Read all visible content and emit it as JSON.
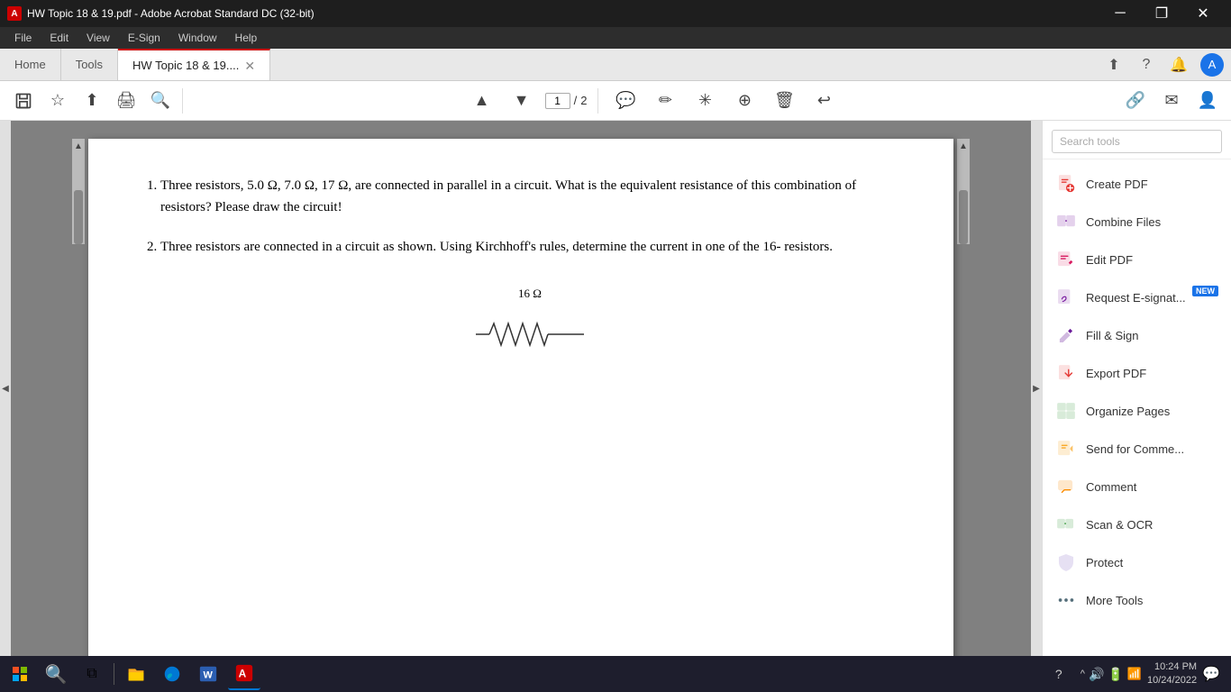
{
  "titleBar": {
    "title": "HW Topic 18 & 19.pdf - Adobe Acrobat Standard DC (32-bit)",
    "icon": "A",
    "controls": {
      "minimize": "─",
      "restore": "❐",
      "close": "✕"
    }
  },
  "menuBar": {
    "items": [
      "File",
      "Edit",
      "View",
      "E-Sign",
      "Window",
      "Help"
    ]
  },
  "tabs": {
    "home": "Home",
    "tools": "Tools",
    "active": "HW Topic 18 & 19....",
    "closeBtn": "✕"
  },
  "toolbar": {
    "pageInput": "1",
    "pageSeparator": "/",
    "pageTotal": "2"
  },
  "toolsPanel": {
    "searchPlaceholder": "Search tools",
    "items": [
      {
        "id": "create-pdf",
        "label": "Create PDF",
        "color": "#e53935",
        "iconChar": "📄"
      },
      {
        "id": "combine-files",
        "label": "Combine Files",
        "color": "#7b1fa2",
        "iconChar": "⊞"
      },
      {
        "id": "edit-pdf",
        "label": "Edit PDF",
        "color": "#d81b60",
        "iconChar": "▤"
      },
      {
        "id": "request-esign",
        "label": "Request E-signat...",
        "color": "#7b1fa2",
        "iconChar": "✏",
        "badge": "NEW"
      },
      {
        "id": "fill-sign",
        "label": "Fill & Sign",
        "color": "#6a1b9a",
        "iconChar": "✍"
      },
      {
        "id": "export-pdf",
        "label": "Export PDF",
        "color": "#e53935",
        "iconChar": "📤"
      },
      {
        "id": "organize-pages",
        "label": "Organize Pages",
        "color": "#43a047",
        "iconChar": "⊟"
      },
      {
        "id": "send-comment",
        "label": "Send for Comme...",
        "color": "#f9a825",
        "iconChar": "📋"
      },
      {
        "id": "comment",
        "label": "Comment",
        "color": "#fb8c00",
        "iconChar": "💬"
      },
      {
        "id": "scan-ocr",
        "label": "Scan & OCR",
        "color": "#43a047",
        "iconChar": "⊞"
      },
      {
        "id": "protect",
        "label": "Protect",
        "color": "#5e35b1",
        "iconChar": "🛡"
      },
      {
        "id": "more-tools",
        "label": "More Tools",
        "color": "#546e7a",
        "iconChar": "🔧"
      }
    ]
  },
  "pdfContent": {
    "question1": "Three resistors, 5.0 Ω, 7.0 Ω, 17 Ω, are connected in parallel in a circuit. What is the equivalent resistance of this combination of resistors? Please draw the circuit!",
    "question2": "Three resistors are connected in a circuit as shown. Using Kirchhoff's rules, determine the current in one of the 16- resistors.",
    "resistorLabel": "16 Ω"
  },
  "taskbar": {
    "startIcon": "⊞",
    "apps": [
      {
        "id": "search",
        "icon": "🔍",
        "active": false
      },
      {
        "id": "taskview",
        "icon": "⧉",
        "active": false
      },
      {
        "id": "explorer",
        "icon": "📁",
        "active": false,
        "color": "#f9a825"
      },
      {
        "id": "edge",
        "icon": "◎",
        "active": false,
        "color": "#0078d4"
      },
      {
        "id": "word",
        "icon": "W",
        "active": false,
        "color": "#2b5eb1"
      },
      {
        "id": "acrobat",
        "icon": "A",
        "active": true,
        "color": "#c00"
      }
    ],
    "systemIcons": {
      "chevron": "^",
      "network": "🔊",
      "battery": "🔋"
    },
    "time": "10:24 PM",
    "date": "10/24/2022",
    "helpIcon": "?",
    "notif": "💬"
  }
}
